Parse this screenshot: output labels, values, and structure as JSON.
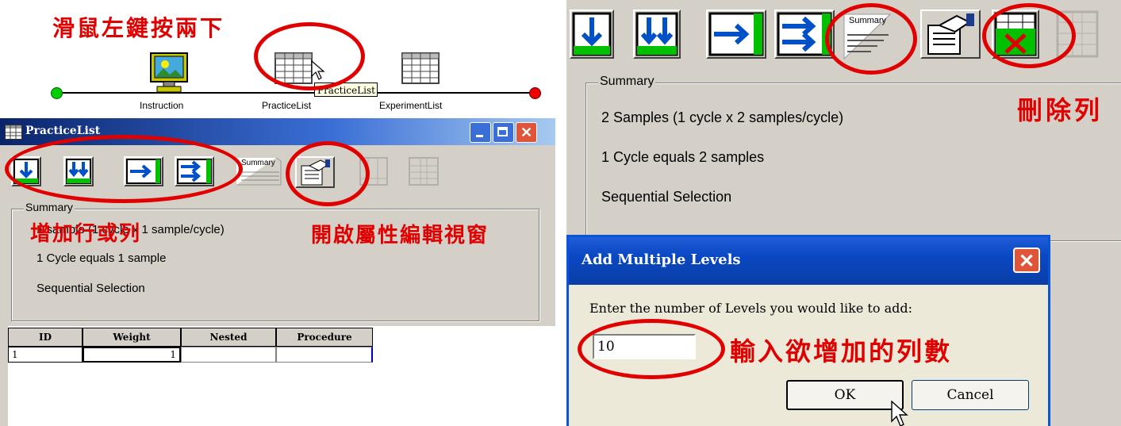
{
  "left": {
    "annotations": {
      "double_click": "滑鼠左鍵按兩下",
      "add_rows_cols": "增加行或列",
      "open_props": "開啟屬性編輯視窗"
    },
    "timeline": {
      "items": [
        "Instruction",
        "PracticeList",
        "ExperimentList"
      ],
      "tooltip": "PracticeList"
    },
    "window": {
      "title": "PracticeList",
      "summary_legend": "Summary",
      "summary_lines": [
        "1 sample (1 cycle x 1 sample/cycle)",
        "1 Cycle equals 1 sample",
        "Sequential Selection"
      ],
      "summary_btn": "Summary",
      "columns": [
        "ID",
        "Weight",
        "Nested",
        "Procedure"
      ],
      "rows": [
        [
          "1",
          "1",
          "",
          ""
        ]
      ]
    }
  },
  "right": {
    "annotations": {
      "delete_row": "刪除列",
      "enter_count": "輸入欲增加的列數"
    },
    "summary_btn": "Summary",
    "summary_legend": "Summary",
    "summary_lines": [
      "2 Samples (1 cycle x 2 samples/cycle)",
      "1 Cycle equals 2 samples",
      "Sequential Selection"
    ],
    "dialog": {
      "title": "Add Multiple Levels",
      "prompt": "Enter the number of Levels you would like to add:",
      "value": "10",
      "ok": "OK",
      "cancel": "Cancel"
    }
  },
  "colors": {
    "annotation_red": "#e10000",
    "title_blue": "#0a246a",
    "face": "#d4d0c8"
  }
}
